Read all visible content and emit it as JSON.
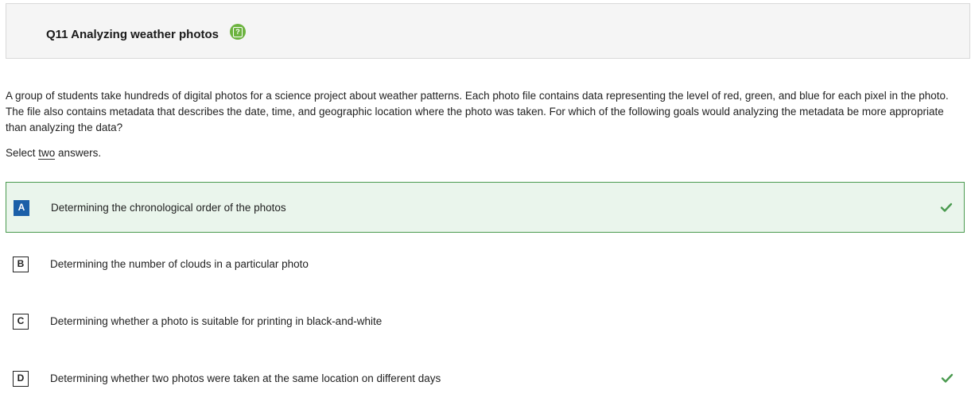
{
  "question": {
    "title": "Q11 Analyzing weather photos",
    "help_icon": "question-help-icon",
    "stem": "A group of students take hundreds of digital photos for a science project about weather patterns. Each photo file contains data representing the level of red, green, and blue for each pixel in the photo. The file also contains metadata that describes the date, time, and geographic location where the photo was taken. For which of the following goals would analyzing the metadata be more appropriate than analyzing the data?",
    "instruction_prefix": "Select ",
    "instruction_emph": "two",
    "instruction_suffix": " answers."
  },
  "options": [
    {
      "letter": "A",
      "text": "Determining the chronological order of the photos",
      "selected": true,
      "correct": true
    },
    {
      "letter": "B",
      "text": "Determining the number of clouds in a particular photo",
      "selected": false,
      "correct": false
    },
    {
      "letter": "C",
      "text": "Determining whether a photo is suitable for printing in black-and-white",
      "selected": false,
      "correct": false
    },
    {
      "letter": "D",
      "text": "Determining whether two photos were taken at the same location on different days",
      "selected": false,
      "correct": true
    }
  ],
  "colors": {
    "accent_green": "#6cb33f",
    "selected_bg": "#eaf5ec",
    "selected_border": "#4a9a4f",
    "selected_letter_bg": "#1b5fa8",
    "check_color": "#4a9a4f"
  }
}
